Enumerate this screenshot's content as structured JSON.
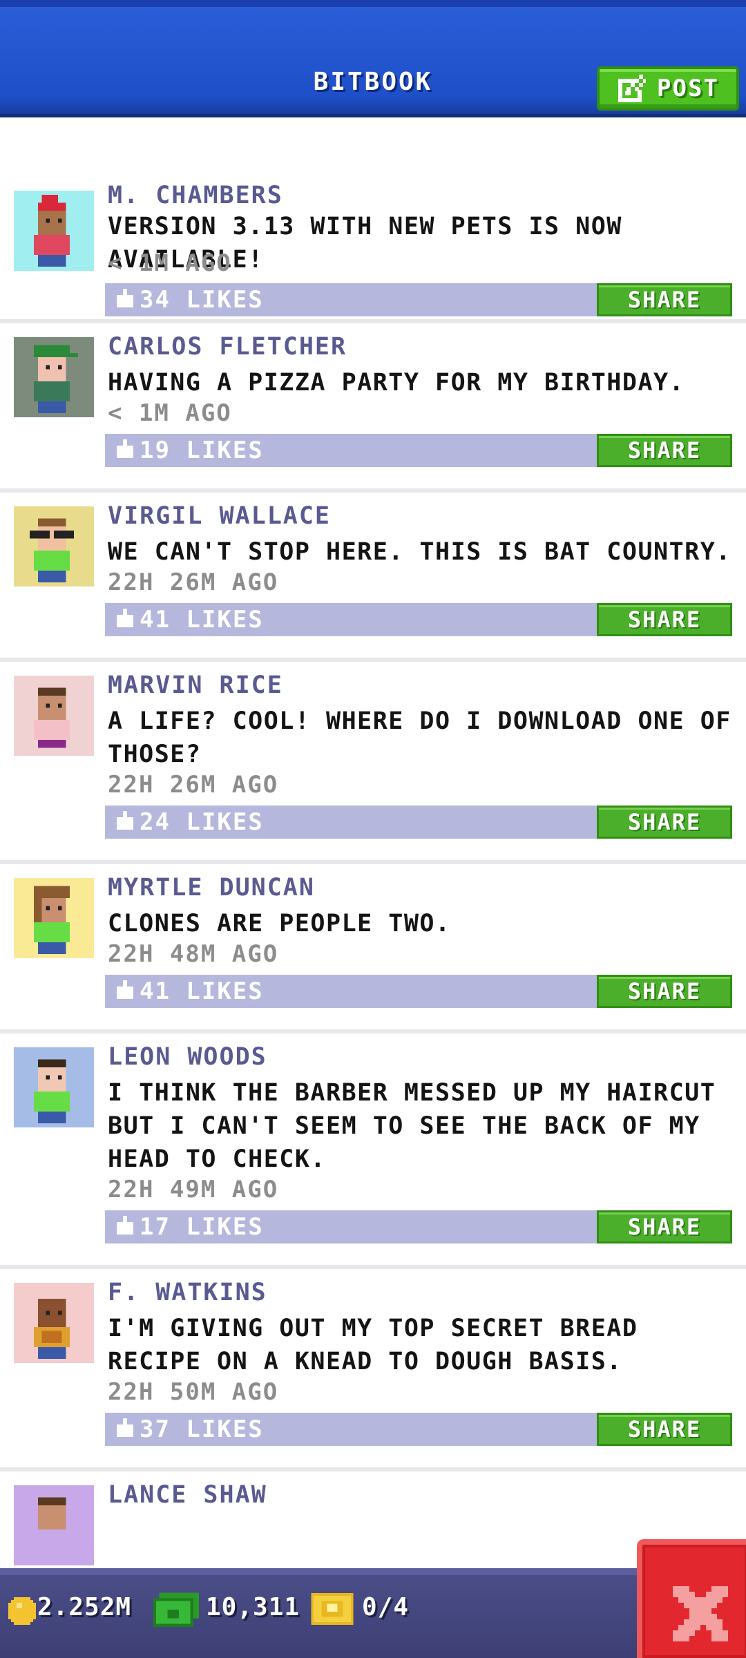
{
  "header": {
    "title": "BITBOOK",
    "post_label": "POST",
    "post_icon": "edit-icon"
  },
  "feed": {
    "posts": [
      {
        "name": "M. CHAMBERS",
        "text": "VERSION 3.13 WITH NEW PETS IS NOW AVAILABLE!",
        "time": "< 1M AGO",
        "likes": "34 LIKES",
        "share": "SHARE",
        "avatar_bg": "#a0eef0"
      },
      {
        "name": "CARLOS FLETCHER",
        "text": "HAVING A PIZZA PARTY FOR MY BIRTHDAY.",
        "time": "< 1M AGO",
        "likes": "19 LIKES",
        "share": "SHARE",
        "avatar_bg": "#7d8b7d"
      },
      {
        "name": "VIRGIL WALLACE",
        "text": "WE CAN'T STOP HERE. THIS IS BAT COUNTRY.",
        "time": "22H 26M AGO",
        "likes": "41 LIKES",
        "share": "SHARE",
        "avatar_bg": "#e8dc8c"
      },
      {
        "name": "MARVIN RICE",
        "text": "A LIFE? COOL! WHERE DO I DOWNLOAD ONE OF THOSE?",
        "time": "22H 26M AGO",
        "likes": "24 LIKES",
        "share": "SHARE",
        "avatar_bg": "#f0d2d2"
      },
      {
        "name": "MYRTLE DUNCAN",
        "text": "CLONES ARE PEOPLE TWO.",
        "time": "22H 48M AGO",
        "likes": "41 LIKES",
        "share": "SHARE",
        "avatar_bg": "#faea96"
      },
      {
        "name": "LEON WOODS",
        "text": "I THINK THE BARBER MESSED UP MY HAIRCUT BUT I CAN'T SEEM TO SEE THE BACK OF MY HEAD TO CHECK.",
        "time": "22H 49M AGO",
        "likes": "17 LIKES",
        "share": "SHARE",
        "avatar_bg": "#a4bce6"
      },
      {
        "name": "F. WATKINS",
        "text": "I'M GIVING OUT MY TOP SECRET BREAD RECIPE ON A KNEAD TO DOUGH BASIS.",
        "time": "22H 50M AGO",
        "likes": "37 LIKES",
        "share": "SHARE",
        "avatar_bg": "#f4cccc"
      },
      {
        "name": "LANCE SHAW",
        "text": "",
        "time": "",
        "likes": "",
        "share": "",
        "avatar_bg": "#c8a8e8"
      }
    ]
  },
  "footer": {
    "coins": "2.252M",
    "bux": "10,311",
    "tickets": "0/4",
    "coin_icon": "coin-icon",
    "bux_icon": "bux-icon",
    "ticket_icon": "ticket-icon",
    "close_icon": "close-icon"
  },
  "colors": {
    "header_blue": "#1e4fc8",
    "accent_green": "#4caf2c",
    "likes_bar": "#b6b7dc",
    "name_purple": "#5a5a92",
    "close_red": "#e2282e"
  }
}
